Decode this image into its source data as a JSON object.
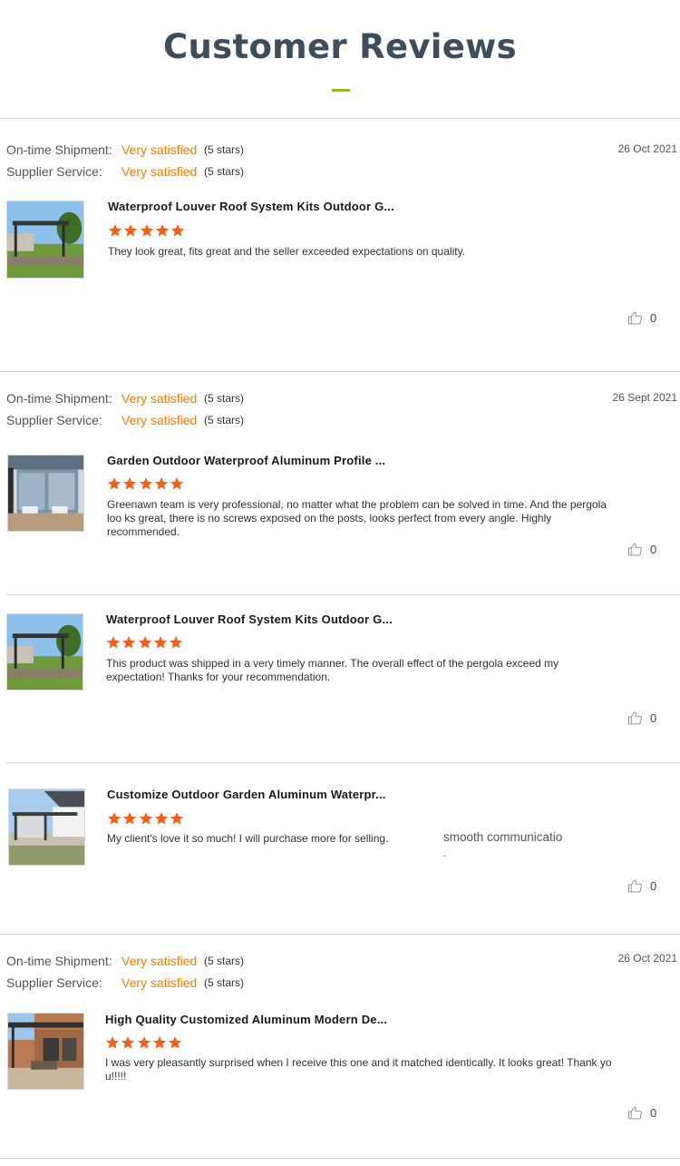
{
  "header": {
    "title": "Customer Reviews"
  },
  "labels": {
    "shipment": "On-time Shipment:",
    "service": "Supplier Service:"
  },
  "reviews": [
    {
      "date": "26 Oct 2021",
      "shipment_rating": "Very satisfied",
      "shipment_stars": "(5 stars)",
      "service_rating": "Very satisfied",
      "service_stars": "(5 stars)",
      "items": [
        {
          "product": "Waterproof Louver Roof System Kits Outdoor G...",
          "stars": 5,
          "text": "They look great, fits great and the seller exceeded expectations on quality.",
          "likes": "0"
        }
      ]
    },
    {
      "date": "26 Sept 2021",
      "shipment_rating": "Very satisfied",
      "shipment_stars": "(5 stars)",
      "service_rating": "Very satisfied",
      "service_stars": "(5 stars)",
      "items": [
        {
          "product": "Garden Outdoor Waterproof Aluminum Profile ...",
          "stars": 5,
          "text": "Greenawn team is very professional, no matter what the problem can be solved in time. And the pergola loo ks great, there is no screws exposed on the posts, looks perfect from every angle. Highly recommended.",
          "likes": "0"
        },
        {
          "product": "Waterproof Louver Roof System Kits Outdoor G...",
          "stars": 5,
          "text": "This product was shipped in a very timely manner. The overall effect of the pergola exceed my expectation! Thanks for your recommendation.",
          "likes": "0"
        },
        {
          "product": "Customize Outdoor Garden Aluminum Waterpr...",
          "stars": 5,
          "text": "My client's love it so much! I will purchase more for selling.",
          "extra": "smooth communicatio",
          "extra_dot": ".",
          "likes": "0"
        }
      ]
    },
    {
      "date": "26 Oct 2021",
      "shipment_rating": "Very satisfied",
      "shipment_stars": "(5 stars)",
      "service_rating": "Very satisfied",
      "service_stars": "(5 stars)",
      "items": [
        {
          "product": "High Quality Customized Aluminum Modern De...",
          "stars": 5,
          "text": "I was very pleasantly surprised when I receive this one and it matched identically. It looks great! Thank yo u!!!!!",
          "likes": "0"
        }
      ]
    }
  ],
  "colors": {
    "title": "#3e4d5c",
    "accent_line": "#8fbc1e",
    "rating_text": "#f07d00",
    "star": "#f06018"
  },
  "icons": {
    "star": "star-icon",
    "like": "thumbs-up-icon"
  }
}
